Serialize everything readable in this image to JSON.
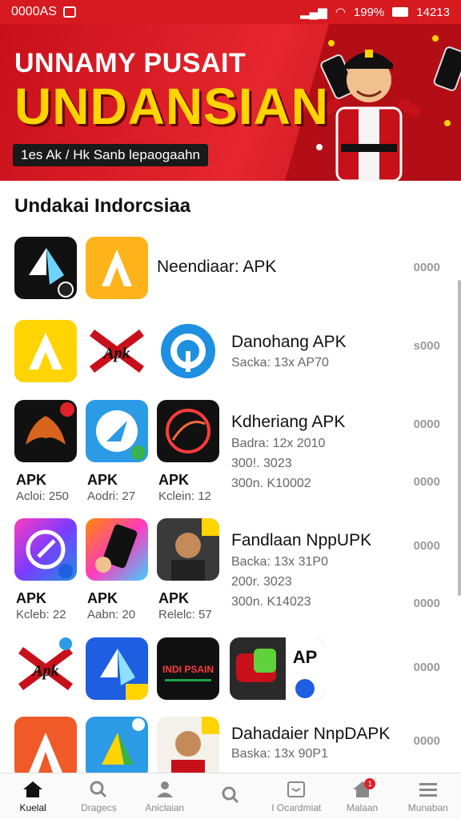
{
  "status_bar": {
    "left_text": "0000AS",
    "battery": "199%",
    "time": "14213"
  },
  "banner": {
    "subtitle": "UNNAMY PUSAIT",
    "title": "UNDANSIAN",
    "tagline": "1es Ak / Hk Sanb lepaogaahn"
  },
  "section_title": "Undakai Indorcsiaa",
  "rows": [
    {
      "name": "Neendiaar: APK",
      "count": "0000"
    },
    {
      "name": "Danohang APK",
      "detail": "Sacka: 13x AP70",
      "count": "s000"
    },
    {
      "name": "Kdheriang APK",
      "details": [
        "Badra: 12x 2010",
        "300!. 3023",
        "300n. K10002"
      ],
      "counts": [
        "0000",
        "0000"
      ],
      "captions": [
        {
          "label": "APK",
          "sub": "Acloi: 250"
        },
        {
          "label": "APK",
          "sub": "Aodri: 27"
        },
        {
          "label": "APK",
          "sub": "Kclein: 12"
        }
      ]
    },
    {
      "name": "Fandlaan NppUPK",
      "details": [
        "Backa: 13x 31P0",
        "200r. 3023",
        "300n. K14023"
      ],
      "counts": [
        "0000",
        "0000"
      ],
      "captions": [
        {
          "label": "APK",
          "sub": "Kcleb: 22"
        },
        {
          "label": "APK",
          "sub": "Aabn: 20"
        },
        {
          "label": "APK",
          "sub": "Relelc: 57"
        }
      ]
    },
    {
      "count": "0000",
      "badge_text": "INDI PSAIN",
      "ap_text": "AP"
    },
    {
      "name": "Dahadaier NnpDAPK",
      "detail": "Baska: 13x 90P1",
      "count": "0000"
    }
  ],
  "bottom_nav": [
    {
      "label": "Kuelal",
      "icon": "home-icon",
      "active": true
    },
    {
      "label": "Dragecs",
      "icon": "search-icon"
    },
    {
      "label": "Aniclaian",
      "icon": "profile-icon"
    },
    {
      "label": "",
      "icon": "search-icon"
    },
    {
      "label": "I Ocardmiat",
      "icon": "inbox-icon"
    },
    {
      "label": "Malaan",
      "icon": "notification-icon",
      "badge": "1"
    },
    {
      "label": "Munaban",
      "icon": "menu-icon"
    }
  ],
  "colors": {
    "accent": "#d71920",
    "banner_yellow": "#ffd400"
  }
}
